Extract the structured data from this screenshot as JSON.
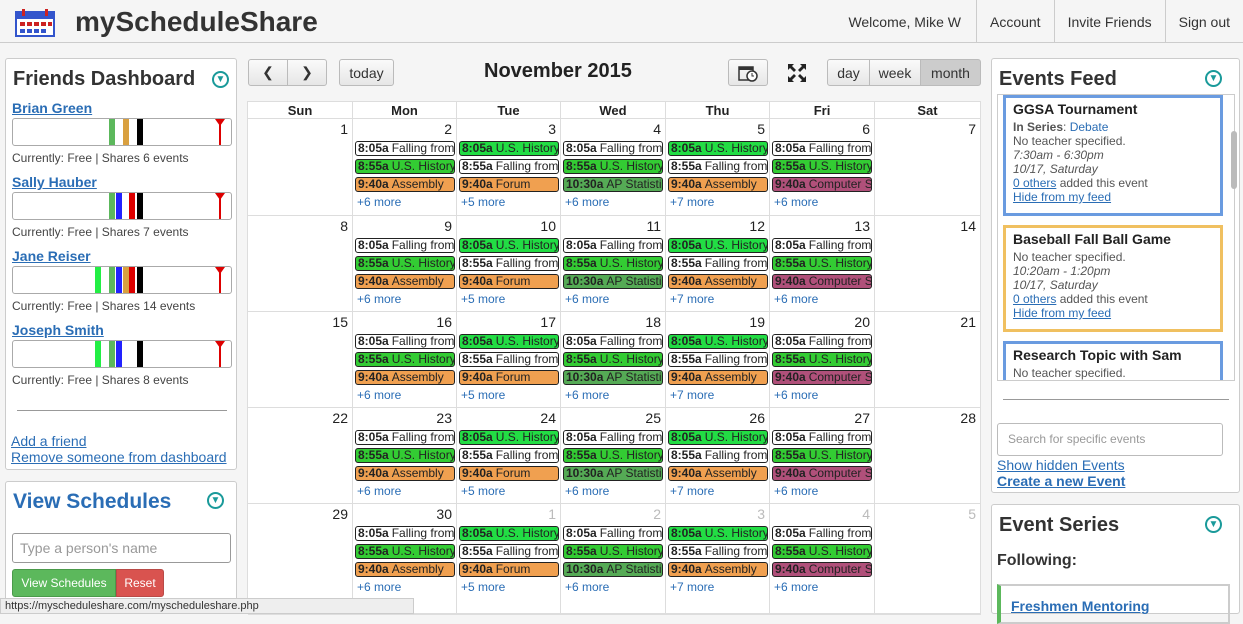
{
  "app": {
    "title": "myScheduleShare"
  },
  "topnav": {
    "welcome": "Welcome, Mike W",
    "account": "Account",
    "invite": "Invite Friends",
    "signout": "Sign out"
  },
  "friends": {
    "title": "Friends Dashboard",
    "list": [
      {
        "name": "Brian Green",
        "status": "Currently: Free | Shares 6 events"
      },
      {
        "name": "Sally Hauber",
        "status": "Currently: Free | Shares 7 events"
      },
      {
        "name": "Jane Reiser",
        "status": "Currently: Free | Shares 14 events"
      },
      {
        "name": "Joseph Smith",
        "status": "Currently: Free | Shares 8 events"
      }
    ],
    "add": "Add a friend",
    "remove": "Remove someone from dashboard"
  },
  "views": {
    "title": "View Schedules",
    "placeholder": "Type a person's name",
    "view_btn": "View Schedules",
    "reset_btn": "Reset"
  },
  "statusbar": {
    "url": "https://myscheduleshare.com/myscheduleshare.php"
  },
  "calendar": {
    "month": "November 2015",
    "today": "today",
    "views": {
      "day": "day",
      "week": "week",
      "month": "month"
    },
    "days": [
      "Sun",
      "Mon",
      "Tue",
      "Wed",
      "Thu",
      "Fri",
      "Sat"
    ],
    "weeks": [
      [
        "1",
        "2",
        "3",
        "4",
        "5",
        "6",
        "7"
      ],
      [
        "8",
        "9",
        "10",
        "11",
        "12",
        "13",
        "14"
      ],
      [
        "15",
        "16",
        "17",
        "18",
        "19",
        "20",
        "21"
      ],
      [
        "22",
        "23",
        "24",
        "25",
        "26",
        "27",
        "28"
      ],
      [
        "29",
        "30",
        "1",
        "2",
        "3",
        "4",
        "5"
      ]
    ],
    "events": {
      "mon": [
        {
          "t": "8:05a",
          "n": "Falling from",
          "c": "#ffffff"
        },
        {
          "t": "8:55a",
          "n": "U.S. History",
          "c": "#33cc33"
        },
        {
          "t": "9:40a",
          "n": "Assembly",
          "c": "#f0a050"
        }
      ],
      "tue": [
        {
          "t": "8:05a",
          "n": "U.S. History",
          "c": "#22dd44"
        },
        {
          "t": "8:55a",
          "n": "Falling from",
          "c": "#ffffff"
        },
        {
          "t": "9:40a",
          "n": "Forum",
          "c": "#f0a050"
        }
      ],
      "wed": [
        {
          "t": "8:05a",
          "n": "Falling from",
          "c": "#ffffff"
        },
        {
          "t": "8:55a",
          "n": "U.S. History",
          "c": "#33cc33"
        },
        {
          "t": "10:30a",
          "n": "AP Statistics",
          "c": "#55aa55"
        }
      ],
      "thu": [
        {
          "t": "8:05a",
          "n": "U.S. History",
          "c": "#22dd44"
        },
        {
          "t": "8:55a",
          "n": "Falling from",
          "c": "#ffffff"
        },
        {
          "t": "9:40a",
          "n": "Assembly",
          "c": "#f0a050"
        }
      ],
      "fri": [
        {
          "t": "8:05a",
          "n": "Falling from",
          "c": "#ffffff"
        },
        {
          "t": "8:55a",
          "n": "U.S. History",
          "c": "#33cc33"
        },
        {
          "t": "9:40a",
          "n": "Computer S",
          "c": "#b0507a"
        }
      ]
    },
    "more": {
      "mon": "+6 more",
      "tue": "+5 more",
      "wed": "+6 more",
      "thu": "+7 more",
      "fri": "+6 more"
    }
  },
  "feed": {
    "title": "Events Feed",
    "cards": [
      {
        "title": "GGSA Tournament",
        "series_label": "In Series",
        "series": "Debate",
        "teacher": "No teacher specified.",
        "time": "7:30am - 6:30pm",
        "date": "10/17, Saturday",
        "others": "0 others",
        "added": " added this event",
        "hide": "Hide from my feed",
        "border": "#6a9be0"
      },
      {
        "title": "Baseball Fall Ball Game",
        "teacher": "No teacher specified.",
        "time": "10:20am - 1:20pm",
        "date": "10/17, Saturday",
        "others": "0 others",
        "added": " added this event",
        "hide": "Hide from my feed",
        "border": "#f0c060"
      },
      {
        "title": "Research Topic with Sam",
        "teacher": "No teacher specified.",
        "border": "#6a9be0"
      }
    ],
    "search_placeholder": "Search for specific events",
    "show_hidden": "Show hidden Events",
    "create_new": "Create a new Event"
  },
  "series": {
    "title": "Event Series",
    "following": "Following:",
    "item": "Freshmen Mentoring"
  }
}
